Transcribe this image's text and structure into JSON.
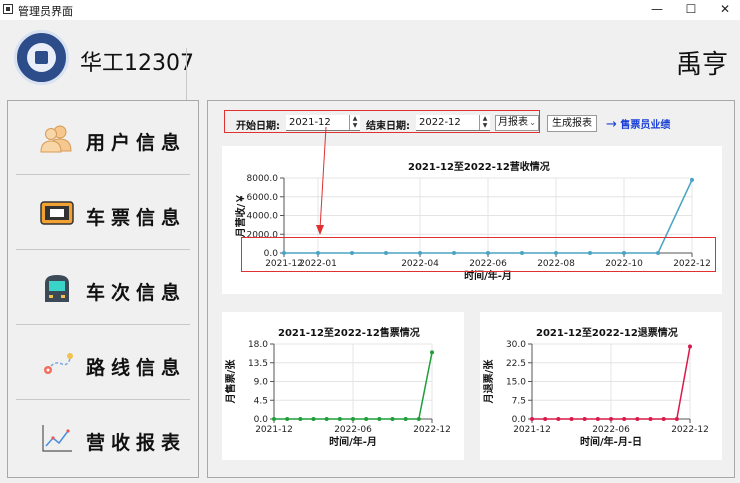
{
  "window": {
    "title": "管理员界面",
    "controls": [
      "—",
      "☐",
      "✕"
    ]
  },
  "header": {
    "brand": "华工12307",
    "user": "禹亨"
  },
  "sidebar": {
    "items": [
      {
        "label": "用户信息",
        "icon": "users-icon"
      },
      {
        "label": "车票信息",
        "icon": "ticket-icon"
      },
      {
        "label": "车次信息",
        "icon": "train-icon"
      },
      {
        "label": "路线信息",
        "icon": "route-icon"
      },
      {
        "label": "营收报表",
        "icon": "chart-icon"
      }
    ]
  },
  "toolbar": {
    "start_label": "开始日期:",
    "start_value": "2021-12",
    "end_label": "结束日期:",
    "end_value": "2022-12",
    "report_type": "月报表",
    "generate_label": "生成报表",
    "link_label": "售票员业绩",
    "link_arrow": "→"
  },
  "chart_data": [
    {
      "id": "revenue",
      "type": "line",
      "title": "2021-12至2022-12营收情况",
      "xlabel": "时间/年-月",
      "ylabel": "月营收/￥",
      "x": [
        "2021-12",
        "2022-01",
        "2022-02",
        "2022-03",
        "2022-04",
        "2022-05",
        "2022-06",
        "2022-07",
        "2022-08",
        "2022-09",
        "2022-10",
        "2022-11",
        "2022-12"
      ],
      "values": [
        0,
        0,
        0,
        0,
        0,
        0,
        0,
        0,
        0,
        0,
        0,
        0,
        7800
      ],
      "xticks": [
        "2021-12",
        "2022-01",
        "2022-04",
        "2022-06",
        "2022-08",
        "2022-10",
        "2022-12"
      ],
      "yticks": [
        "0.0",
        "2000.0",
        "4000.0",
        "6000.0",
        "8000.0"
      ],
      "ylim": [
        0,
        8000
      ],
      "color": "#4aa3c3"
    },
    {
      "id": "sales",
      "type": "line",
      "title": "2021-12至2022-12售票情况",
      "xlabel": "时间/年-月",
      "ylabel": "月售票/张",
      "x": [
        "2021-12",
        "2022-01",
        "2022-02",
        "2022-03",
        "2022-04",
        "2022-05",
        "2022-06",
        "2022-07",
        "2022-08",
        "2022-09",
        "2022-10",
        "2022-11",
        "2022-12"
      ],
      "values": [
        0,
        0,
        0,
        0,
        0,
        0,
        0,
        0,
        0,
        0,
        0,
        0,
        16
      ],
      "xticks": [
        "2021-12",
        "2022-06",
        "2022-12"
      ],
      "yticks": [
        "0.0",
        "4.5",
        "9.0",
        "13.5",
        "18.0"
      ],
      "ylim": [
        0,
        18
      ],
      "color": "#1f9e3a"
    },
    {
      "id": "refund",
      "type": "line",
      "title": "2021-12至2022-12退票情况",
      "xlabel": "时间/年-月-日",
      "ylabel": "月退票/张",
      "x": [
        "2021-12",
        "2022-01",
        "2022-02",
        "2022-03",
        "2022-04",
        "2022-05",
        "2022-06",
        "2022-07",
        "2022-08",
        "2022-09",
        "2022-10",
        "2022-11",
        "2022-12"
      ],
      "values": [
        0,
        0,
        0,
        0,
        0,
        0,
        0,
        0,
        0,
        0,
        0,
        0,
        29
      ],
      "xticks": [
        "2021-12",
        "2022-06",
        "2022-12"
      ],
      "yticks": [
        "0.0",
        "7.5",
        "15.0",
        "22.5",
        "30.0"
      ],
      "ylim": [
        0,
        30
      ],
      "color": "#d81b4a"
    }
  ]
}
